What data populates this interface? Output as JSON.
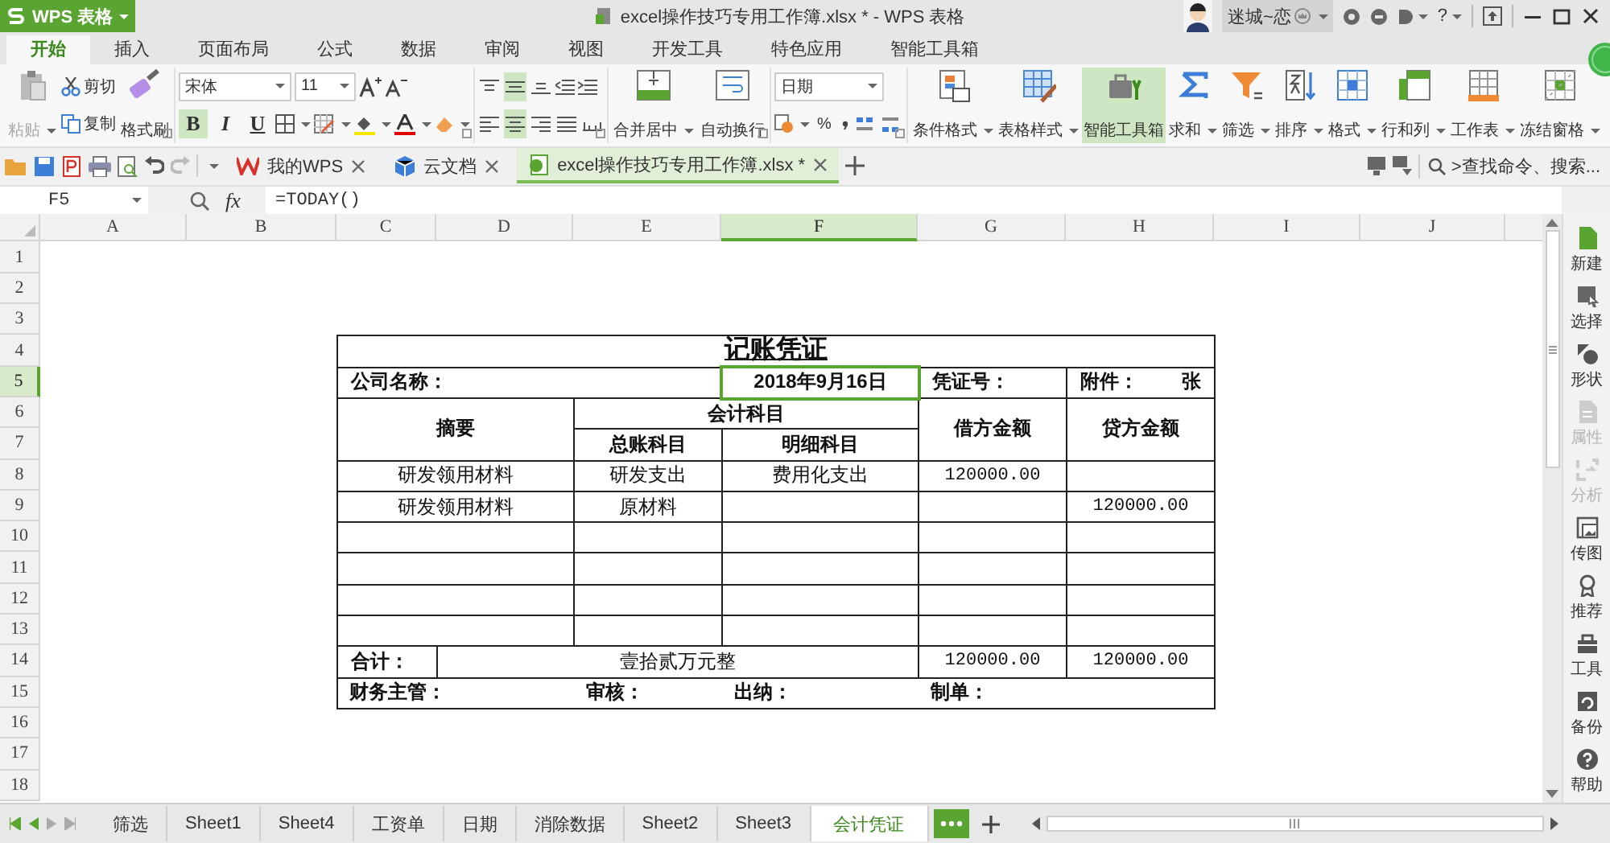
{
  "title_bar": {
    "app_menu": "WPS 表格",
    "title": "excel操作技巧专用工作簿.xlsx * - WPS 表格",
    "user": "迷城~恋",
    "help": "?"
  },
  "menu_tabs": [
    {
      "label": "开始",
      "selected": true
    },
    {
      "label": "插入",
      "selected": false
    },
    {
      "label": "页面布局",
      "selected": false
    },
    {
      "label": "公式",
      "selected": false
    },
    {
      "label": "数据",
      "selected": false
    },
    {
      "label": "审阅",
      "selected": false
    },
    {
      "label": "视图",
      "selected": false
    },
    {
      "label": "开发工具",
      "selected": false
    },
    {
      "label": "特色应用",
      "selected": false
    },
    {
      "label": "智能工具箱",
      "selected": false
    }
  ],
  "ribbon": {
    "paste": {
      "label": "粘贴",
      "disabled": true
    },
    "cut": "剪切",
    "copy": "复制",
    "format_painter": "格式刷",
    "font_name": "宋体",
    "font_size": "11",
    "bold": {
      "label": "B",
      "on": true
    },
    "italic": {
      "label": "I",
      "on": false
    },
    "underline": {
      "label": "U",
      "on": false
    },
    "vertical_align": [
      {
        "selected": false
      },
      {
        "selected": true
      },
      {
        "selected": false
      }
    ],
    "horizontal_align": [
      {
        "selected": false
      },
      {
        "selected": true
      },
      {
        "selected": false
      },
      {
        "selected": false
      },
      {
        "selected": false
      }
    ],
    "merge": "合并居中",
    "wrap": "自动换行",
    "number_format": "日期",
    "percent": "%",
    "tools": [
      {
        "label": "条件格式",
        "dropdown": true,
        "active": false
      },
      {
        "label": "表格样式",
        "dropdown": true,
        "active": false
      },
      {
        "label": "智能工具箱",
        "dropdown": false,
        "active": true
      },
      {
        "label": "求和",
        "dropdown": true,
        "active": false
      },
      {
        "label": "筛选",
        "dropdown": true,
        "active": false
      },
      {
        "label": "排序",
        "dropdown": true,
        "active": false
      },
      {
        "label": "格式",
        "dropdown": true,
        "active": false
      },
      {
        "label": "行和列",
        "dropdown": true,
        "active": false
      },
      {
        "label": "工作表",
        "dropdown": true,
        "active": false
      },
      {
        "label": "冻结窗格",
        "dropdown": true,
        "active": false
      }
    ]
  },
  "doc_tabs": {
    "tabs": [
      {
        "label": "我的WPS",
        "selected": false
      },
      {
        "label": "云文档",
        "selected": false
      },
      {
        "label": "excel操作技巧专用工作簿.xlsx *",
        "selected": true
      }
    ],
    "search": ">查找命令、搜索..."
  },
  "formula_bar": {
    "cell": "F5",
    "fx": "fx",
    "formula": "=TODAY()"
  },
  "sheet": {
    "columns": [
      {
        "label": "A",
        "selected": false
      },
      {
        "label": "B",
        "selected": false
      },
      {
        "label": "C",
        "selected": false
      },
      {
        "label": "D",
        "selected": false
      },
      {
        "label": "E",
        "selected": false
      },
      {
        "label": "F",
        "selected": true
      },
      {
        "label": "G",
        "selected": false
      },
      {
        "label": "H",
        "selected": false
      },
      {
        "label": "I",
        "selected": false
      },
      {
        "label": "J",
        "selected": false
      }
    ],
    "rows": [
      {
        "label": "1",
        "selected": false
      },
      {
        "label": "2",
        "selected": false
      },
      {
        "label": "3",
        "selected": false
      },
      {
        "label": "4",
        "selected": false
      },
      {
        "label": "5",
        "selected": true
      },
      {
        "label": "6",
        "selected": false
      },
      {
        "label": "7",
        "selected": false
      },
      {
        "label": "8",
        "selected": false
      },
      {
        "label": "9",
        "selected": false
      },
      {
        "label": "10",
        "selected": false
      },
      {
        "label": "11",
        "selected": false
      },
      {
        "label": "12",
        "selected": false
      },
      {
        "label": "13",
        "selected": false
      },
      {
        "label": "14",
        "selected": false
      },
      {
        "label": "15",
        "selected": false
      },
      {
        "label": "16",
        "selected": false
      },
      {
        "label": "17",
        "selected": false
      },
      {
        "label": "18",
        "selected": false
      }
    ],
    "voucher": {
      "title": "记账凭证",
      "company_label": "公司名称：",
      "date": {
        "text": "2018年9月16日",
        "selected": true
      },
      "number_label": "凭证号：",
      "attachment_label": "附件：",
      "attachment_unit": "张",
      "headers": {
        "summary": "摘要",
        "subjects": "会计科目",
        "general": "总账科目",
        "detail": "明细科目",
        "debit": "借方金额",
        "credit": "贷方金额"
      },
      "lines": [
        {
          "summary": "研发领用材料",
          "general": "研发支出",
          "detail": "费用化支出",
          "debit": "120000.00"
        },
        {
          "summary": "研发领用材料",
          "general": "原材料",
          "credit": "120000.00"
        }
      ],
      "total": {
        "label": "合计：",
        "amount_words": "壹拾贰万元整",
        "debit": "120000.00",
        "credit": "120000.00"
      },
      "signatures": [
        "财务主管：",
        "审核：",
        "出纳：",
        "制单："
      ]
    }
  },
  "sidebar": [
    {
      "label": "新建",
      "disabled": false
    },
    {
      "label": "选择",
      "disabled": false
    },
    {
      "label": "形状",
      "disabled": false
    },
    {
      "label": "属性",
      "disabled": true
    },
    {
      "label": "分析",
      "disabled": true
    },
    {
      "label": "传图",
      "disabled": false
    },
    {
      "label": "推荐",
      "disabled": false
    },
    {
      "label": "工具",
      "disabled": false
    },
    {
      "label": "备份",
      "disabled": false
    },
    {
      "label": "帮助",
      "disabled": false
    }
  ],
  "sheet_tabs": [
    {
      "label": "筛选",
      "selected": false
    },
    {
      "label": "Sheet1",
      "selected": false
    },
    {
      "label": "Sheet4",
      "selected": false
    },
    {
      "label": "工资单",
      "selected": false
    },
    {
      "label": "日期",
      "selected": false
    },
    {
      "label": "消除数据",
      "selected": false
    },
    {
      "label": "Sheet2",
      "selected": false
    },
    {
      "label": "Sheet3",
      "selected": false
    },
    {
      "label": "会计凭证",
      "selected": true
    }
  ]
}
